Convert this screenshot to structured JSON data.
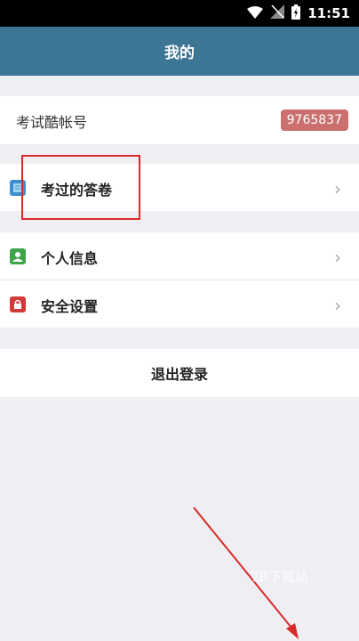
{
  "status_bar": {
    "time": "11:51",
    "icons": [
      "wifi-icon",
      "no-signal-icon",
      "battery-icon"
    ]
  },
  "header": {
    "title": "我的"
  },
  "account": {
    "label": "考试酷帐号",
    "number": "9765837",
    "badge_color": "#cb6f6f"
  },
  "menu": {
    "items": [
      {
        "label": "考过的答卷",
        "icon": "answer-sheet-icon",
        "icon_color": "#3a8fd0"
      },
      {
        "label": "个人信息",
        "icon": "person-icon",
        "icon_color": "#3ea44a"
      },
      {
        "label": "安全设置",
        "icon": "lock-icon",
        "icon_color": "#d23a3a"
      }
    ]
  },
  "logout": {
    "label": "退出登录"
  },
  "colors": {
    "header_bg": "#3d7595",
    "page_bg": "#efeef2",
    "annotation_red": "#d92a2a"
  },
  "watermark": {
    "text": "7B下载站"
  }
}
